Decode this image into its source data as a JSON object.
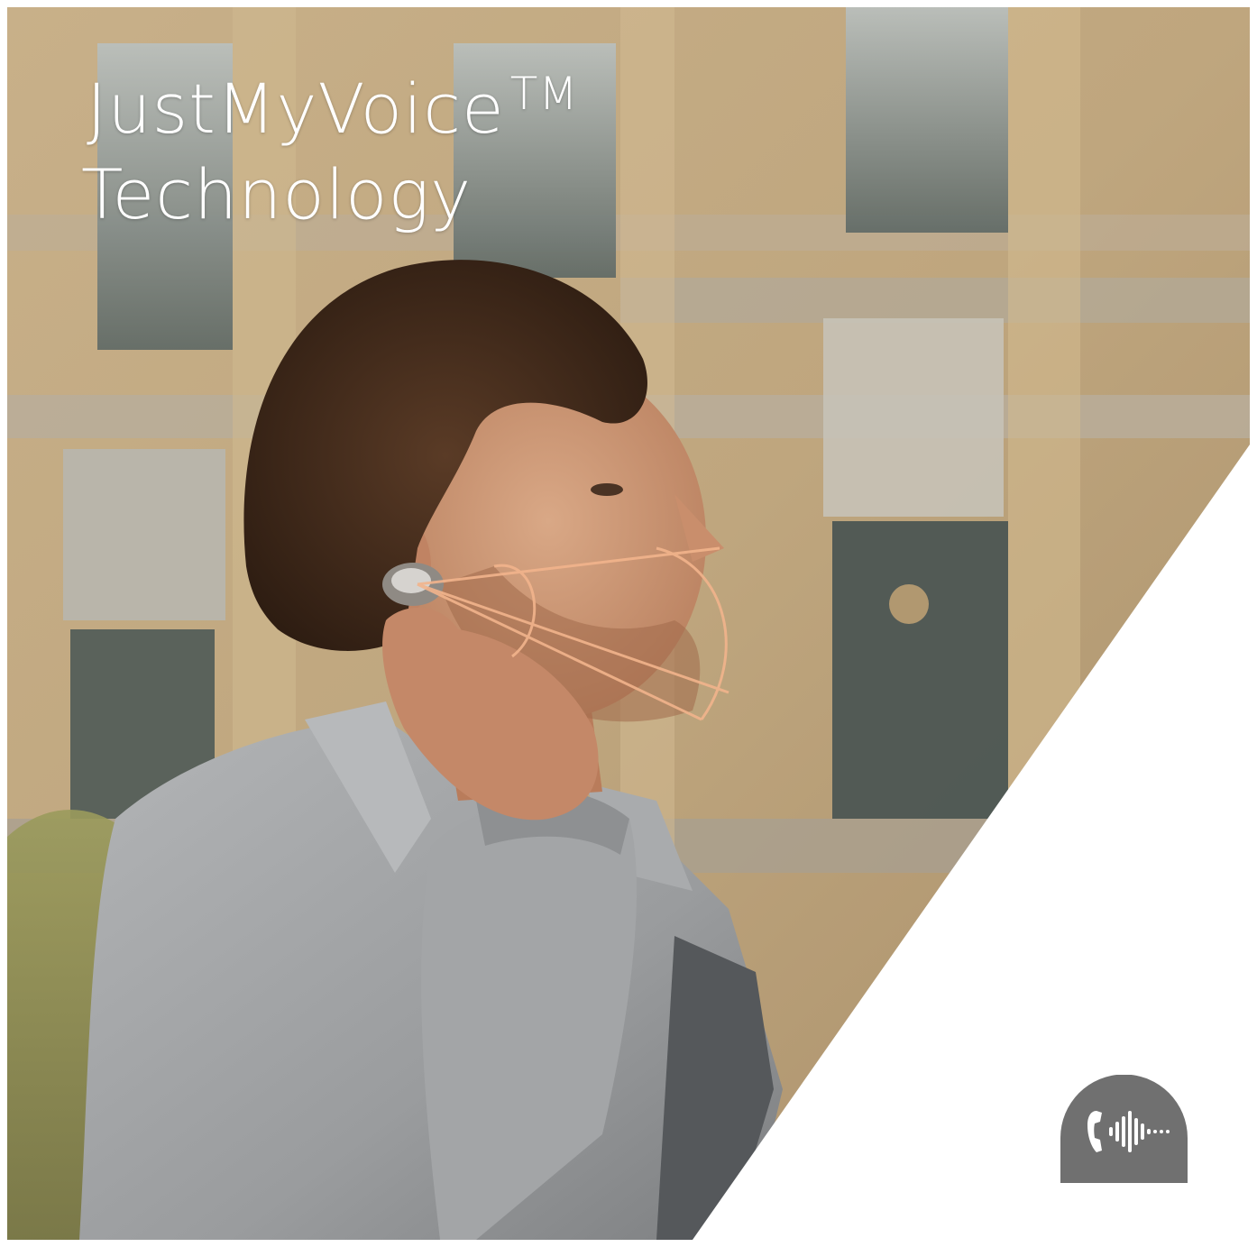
{
  "headline": {
    "line1": "JustMyVoice",
    "trademark": "TM",
    "line2": "Technology"
  },
  "photo": {
    "subject_icon": "man-with-earbud-photo"
  },
  "badge": {
    "icon": "voice-call-icon",
    "color": "#707070"
  },
  "colors": {
    "building_tan": "#c9b28a",
    "jacket_gray": "#9c9ea0",
    "accent_orange": "#e8a27a",
    "background_white": "#ffffff"
  }
}
